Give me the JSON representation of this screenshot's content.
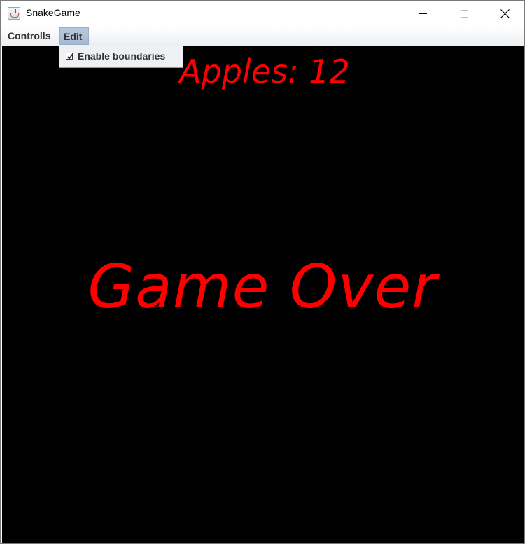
{
  "window": {
    "title": "SnakeGame",
    "app_icon": "java-cup-icon"
  },
  "titlebar_buttons": {
    "minimize_icon": "minimize-icon",
    "maximize_icon": "maximize-icon",
    "close_icon": "close-icon"
  },
  "menubar": {
    "menus": [
      {
        "label": "Controlls"
      },
      {
        "label": "Edit",
        "state": "open"
      }
    ]
  },
  "edit_menu": {
    "items": [
      {
        "label": "Enable boundaries",
        "checked": true
      }
    ]
  },
  "game": {
    "score_text": "Apples: 12",
    "status_text": "Game Over",
    "background_color": "#000000",
    "text_color": "#ff0000"
  }
}
